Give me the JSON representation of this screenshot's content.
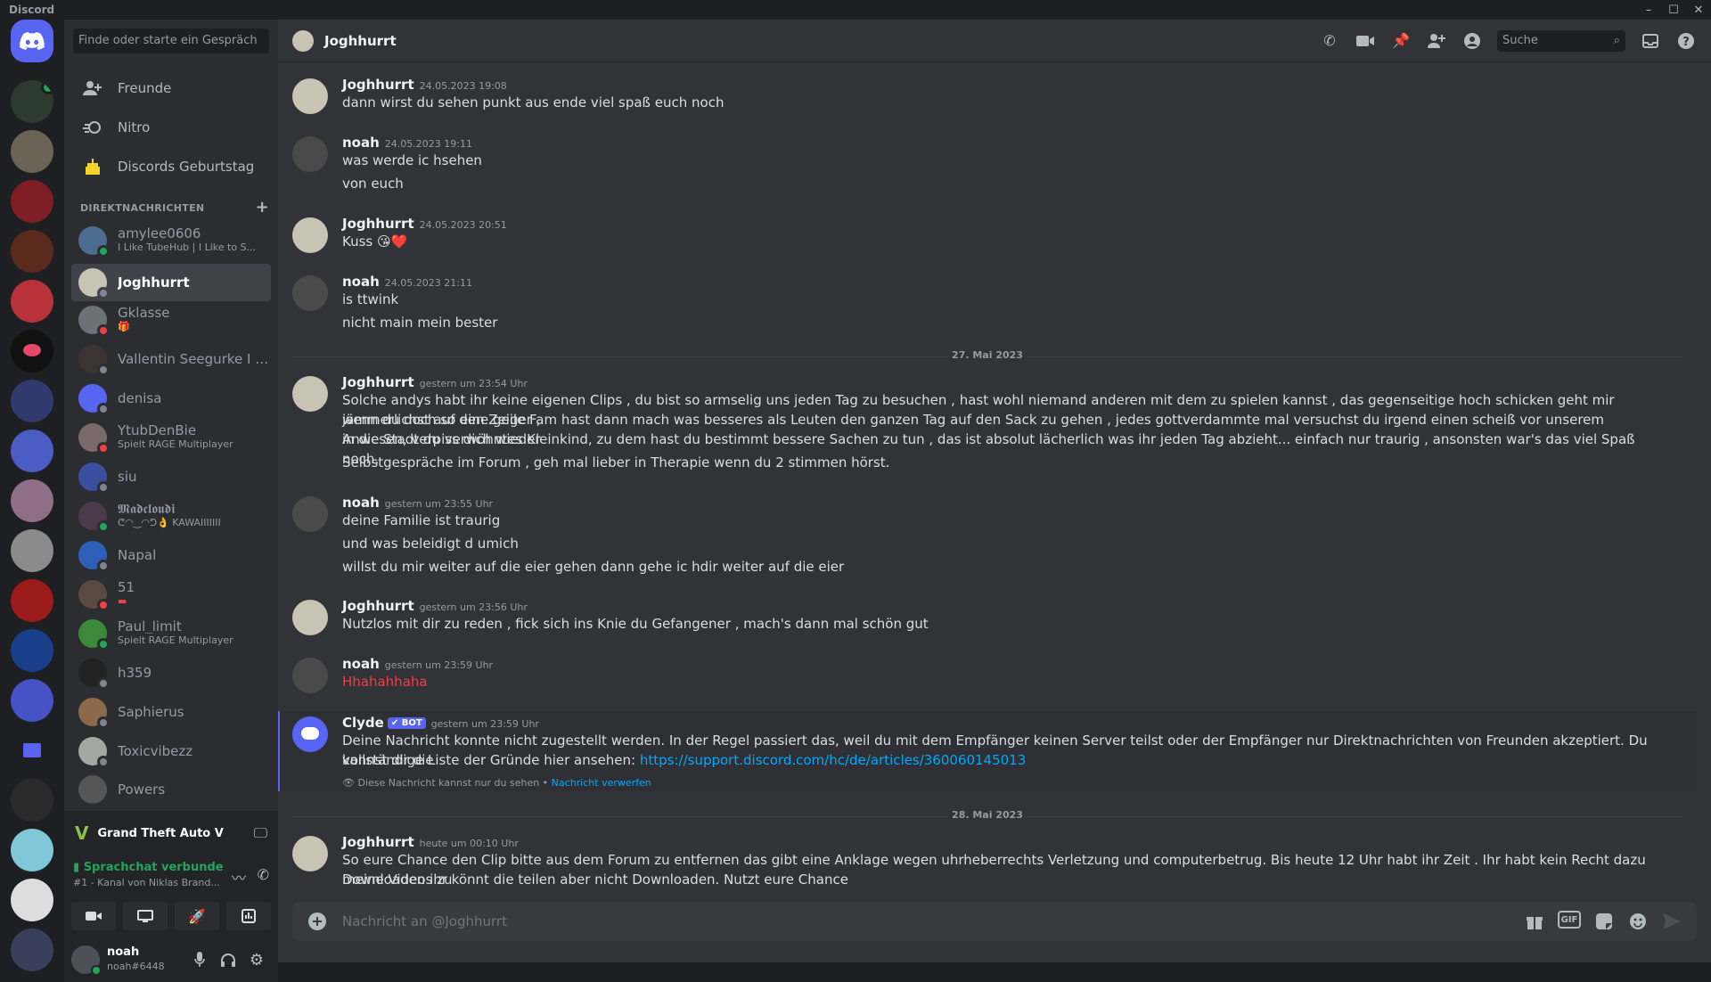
{
  "app": {
    "title": "Discord"
  },
  "sidebar": {
    "search_placeholder": "Finde oder starte ein Gespräch",
    "nav": [
      {
        "label": "Freunde"
      },
      {
        "label": "Nitro"
      },
      {
        "label": "Discords Geburtstag"
      }
    ],
    "dm_header": "DIREKTNACHRICHTEN",
    "dms": [
      {
        "name": "amylee0606",
        "sub": "I Like TubeHub | I Like to S...",
        "status": "online"
      },
      {
        "name": "Joghhurrt",
        "sub": "",
        "status": "offline"
      },
      {
        "name": "Gklasse",
        "sub": "",
        "status": "dnd"
      },
      {
        "name": "Vallentin Seegurke I 11...",
        "sub": "",
        "status": "offline"
      },
      {
        "name": "denisa",
        "sub": "",
        "status": "offline"
      },
      {
        "name": "YtubDenBie",
        "sub": "Spielt RAGE Multiplayer",
        "status": "dnd"
      },
      {
        "name": "siu",
        "sub": "",
        "status": "offline"
      },
      {
        "name": "𝕸𝖆𝖉𝖈𝖑𝖔𝖚𝖉𝖎",
        "sub": "ᕦ◠‿◠ᕤ👌 KAWAIIIIIII",
        "status": "online"
      },
      {
        "name": "Napal",
        "sub": "",
        "status": "offline"
      },
      {
        "name": "51",
        "sub": "",
        "status": "dnd"
      },
      {
        "name": "Paul_limit",
        "sub": "Spielt RAGE Multiplayer",
        "status": "online"
      },
      {
        "name": "h359",
        "sub": "",
        "status": "offline"
      },
      {
        "name": "Saphierus",
        "sub": "",
        "status": "offline"
      },
      {
        "name": "Toxicvibezz",
        "sub": "",
        "status": "offline"
      },
      {
        "name": "Powers",
        "sub": "",
        "status": "offline"
      }
    ],
    "game": {
      "name": "Grand Theft Auto V"
    },
    "voice": {
      "title": "Sprachchat verbunde",
      "subtitle": "#1 - Kanal von Niklas Brand..."
    },
    "user": {
      "name": "noah",
      "tag": "noah#6448"
    }
  },
  "channel": {
    "name": "Joghhurrt",
    "search_placeholder": "Suche"
  },
  "messages": [
    {
      "author": "Joghhurrt",
      "ts": "24.05.2023 19:08",
      "lines": [
        "dann wirst du sehen punkt aus ende viel spaß euch noch"
      ]
    },
    {
      "author": "noah",
      "ts": "24.05.2023 19:11",
      "lines": [
        "was werde ic hsehen",
        "von euch"
      ]
    },
    {
      "author": "Joghhurrt",
      "ts": "24.05.2023 20:51",
      "lines": [
        "Kuss 😘❤️"
      ]
    },
    {
      "author": "noah",
      "ts": "24.05.2023 21:11",
      "lines": [
        "is ttwink",
        "nicht main mein bester"
      ]
    },
    {
      "author": "Joghhurrt",
      "ts": "gestern um 23:54 Uhr",
      "lines": [
        "Solche andys habt ihr keine eigenen Clips , du bist so armselig uns jeden Tag zu besuchen , hast wohl niemand anderen mit dem zu spielen kannst , das gegenseitige hoch schicken geht mir jämmerlichst auf den Zeiger ,",
        "wenn du doch so eine geile Fam hast dann mach was besseres als Leuten den ganzen Tag auf den Sack zu gehen , jedes gottverdammte mal versuchst du irgend einen scheiß vor unserem Anwesen, verpiss dich wieder",
        "in die Stadt du verwöhntes Kleinkind, zu dem hast du bestimmt bessere Sachen zu tun , das ist absolut lächerlich was ihr jeden Tag abzieht... einfach nur traurig , ansonsten war's das viel Spaß noch.",
        "Selbstgespräche im Forum , geh mal lieber in Therapie wenn du 2 stimmen hörst."
      ]
    },
    {
      "author": "noah",
      "ts": "gestern um 23:55 Uhr",
      "lines": [
        "deine Familie ist traurig",
        "und was beleidigt d umich",
        "willst du mir weiter auf die eier gehen dann gehe ic hdir weiter auf die eier"
      ]
    },
    {
      "author": "Joghhurrt",
      "ts": "gestern um 23:56 Uhr",
      "lines": [
        "Nutzlos mit dir zu reden , fick sich ins Knie du Gefangener , mach's dann mal schön gut"
      ]
    },
    {
      "author": "noah",
      "ts": "gestern um 23:59 Uhr",
      "lines": [
        "Hhahahhaha"
      ]
    },
    {
      "author": "Clyde",
      "bot_tag": "✔ BOT",
      "ts": "gestern um 23:59 Uhr",
      "lines": [
        "Deine Nachricht konnte nicht zugestellt werden. In der Regel passiert das, weil du mit dem Empfänger keinen Server teilst oder der Empfänger nur Direktnachrichten von Freunden akzeptiert. Du kannst dir die",
        "vollständige Liste der Gründe hier ansehen: "
      ],
      "link": "https://support.discord.com/hc/de/articles/360060145013",
      "ephemeral": "Diese Nachricht kannst nur du sehen • ",
      "dismiss": "Nachricht verwerfen"
    },
    {
      "author": "Joghhurrt",
      "ts": "heute um 00:10 Uhr",
      "lines": [
        "So eure Chance den Clip bitte aus dem Forum zu entfernen das gibt eine Anklage wegen uhrheberrechts Verletzung und computerbetrug. Bis heute 12 Uhr habt ihr Zeit . Ihr habt kein Recht dazu meine Videos zu",
        "Downloaden ihr könnt die teilen aber nicht Downloaden. Nutzt eure Chance"
      ]
    }
  ],
  "dividers": [
    "27. Mai 2023",
    "28. Mai 2023"
  ],
  "composer": {
    "placeholder": "Nachricht an @Joghhurrt",
    "gif_label": "GIF"
  },
  "colors": {
    "accent": "#5865f2",
    "online": "#23a55a",
    "dnd": "#f23f42",
    "link": "#00a8fc"
  }
}
